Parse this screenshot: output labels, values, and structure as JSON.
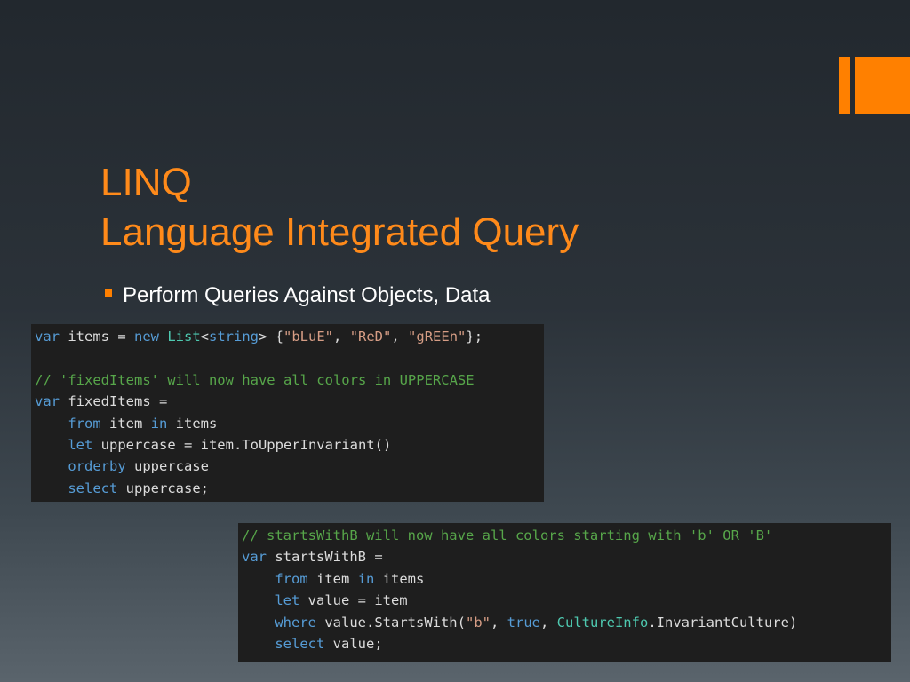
{
  "slide": {
    "title_line1": "LINQ",
    "title_line2": "Language Integrated Query",
    "bullet": "Perform Queries Against Objects, Data"
  },
  "colors": {
    "accent": "#ff8000",
    "title": "#ff8a1a",
    "code_bg": "#1e1e1e",
    "keyword": "#569cd6",
    "type": "#4ec9b0",
    "string": "#d69d85",
    "comment": "#57a64a"
  },
  "code1": [
    [
      {
        "t": "var",
        "c": "kw"
      },
      {
        "t": " items = "
      },
      {
        "t": "new",
        "c": "kw"
      },
      {
        "t": " "
      },
      {
        "t": "List",
        "c": "ty"
      },
      {
        "t": "<"
      },
      {
        "t": "string",
        "c": "kw"
      },
      {
        "t": "> {"
      },
      {
        "t": "\"bLuE\"",
        "c": "st"
      },
      {
        "t": ", "
      },
      {
        "t": "\"ReD\"",
        "c": "st"
      },
      {
        "t": ", "
      },
      {
        "t": "\"gREEn\"",
        "c": "st"
      },
      {
        "t": "};"
      }
    ],
    [],
    [
      {
        "t": "// 'fixedItems' will now have all colors in UPPERCASE",
        "c": "cm"
      }
    ],
    [
      {
        "t": "var",
        "c": "kw"
      },
      {
        "t": " fixedItems ="
      }
    ],
    [
      {
        "t": "    "
      },
      {
        "t": "from",
        "c": "kw"
      },
      {
        "t": " item "
      },
      {
        "t": "in",
        "c": "kw"
      },
      {
        "t": " items"
      }
    ],
    [
      {
        "t": "    "
      },
      {
        "t": "let",
        "c": "kw"
      },
      {
        "t": " uppercase = item.ToUpperInvariant()"
      }
    ],
    [
      {
        "t": "    "
      },
      {
        "t": "orderby",
        "c": "kw"
      },
      {
        "t": " uppercase"
      }
    ],
    [
      {
        "t": "    "
      },
      {
        "t": "select",
        "c": "kw"
      },
      {
        "t": " uppercase;"
      }
    ]
  ],
  "code2": [
    [
      {
        "t": "// startsWithB will now have all colors starting with 'b' OR 'B'",
        "c": "cm"
      }
    ],
    [
      {
        "t": "var",
        "c": "kw"
      },
      {
        "t": " startsWithB ="
      }
    ],
    [
      {
        "t": "    "
      },
      {
        "t": "from",
        "c": "kw"
      },
      {
        "t": " item "
      },
      {
        "t": "in",
        "c": "kw"
      },
      {
        "t": " items"
      }
    ],
    [
      {
        "t": "    "
      },
      {
        "t": "let",
        "c": "kw"
      },
      {
        "t": " value = item"
      }
    ],
    [
      {
        "t": "    "
      },
      {
        "t": "where",
        "c": "kw"
      },
      {
        "t": " value.StartsWith("
      },
      {
        "t": "\"b\"",
        "c": "st"
      },
      {
        "t": ", "
      },
      {
        "t": "true",
        "c": "kw"
      },
      {
        "t": ", "
      },
      {
        "t": "CultureInfo",
        "c": "ty"
      },
      {
        "t": ".InvariantCulture)"
      }
    ],
    [
      {
        "t": "    "
      },
      {
        "t": "select",
        "c": "kw"
      },
      {
        "t": " value;"
      }
    ]
  ]
}
